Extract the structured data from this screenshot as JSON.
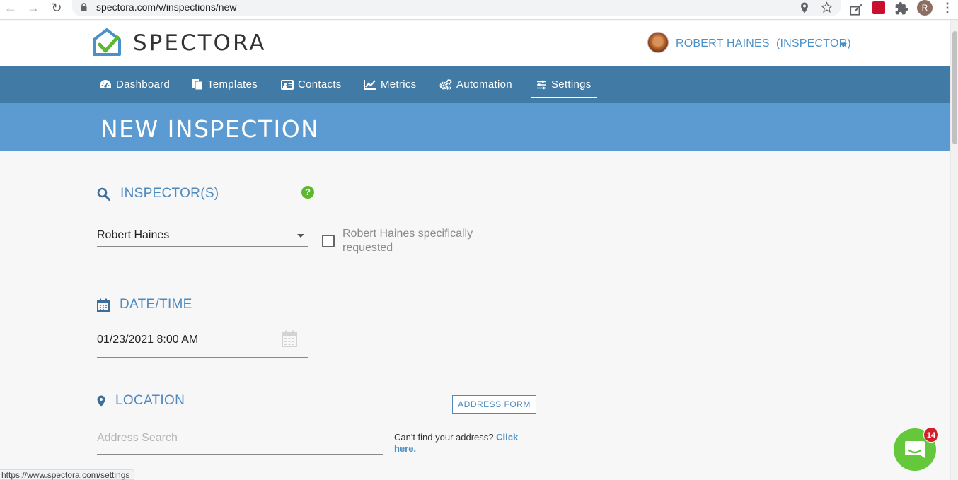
{
  "browser": {
    "url": "spectora.com/v/inspections/new",
    "profile_initial": "R",
    "status_url": "https://www.spectora.com/settings"
  },
  "header": {
    "logo_text": "SPECTORA",
    "user_label": "ROBERT HAINES  (INSPECTOR)"
  },
  "nav": {
    "items": [
      {
        "label": "Dashboard",
        "icon": "dashboard-icon"
      },
      {
        "label": "Templates",
        "icon": "templates-icon"
      },
      {
        "label": "Contacts",
        "icon": "contacts-icon"
      },
      {
        "label": "Metrics",
        "icon": "metrics-icon"
      },
      {
        "label": "Automation",
        "icon": "automation-icon"
      },
      {
        "label": "Settings",
        "icon": "settings-icon",
        "active": true
      }
    ]
  },
  "page": {
    "title": "NEW INSPECTION"
  },
  "inspectors": {
    "heading": "INSPECTOR(S)",
    "selected": "Robert Haines",
    "requested_label": "Robert Haines specifically requested",
    "requested_checked": false
  },
  "datetime": {
    "heading": "DATE/TIME",
    "value": "01/23/2021 8:00 AM"
  },
  "location": {
    "heading": "LOCATION",
    "address_form_button": "ADDRESS FORM",
    "search_placeholder": "Address Search",
    "cant_find_text": "Can't find your address?",
    "click_here": "Click here."
  },
  "chat": {
    "badge_count": "14"
  },
  "colors": {
    "nav_bg": "#417aa4",
    "banner_bg": "#5b9bd1",
    "accent": "#4d8ac0",
    "help_green": "#5cb82f",
    "chat_green": "#64c83a",
    "badge_red": "#d0202a"
  }
}
